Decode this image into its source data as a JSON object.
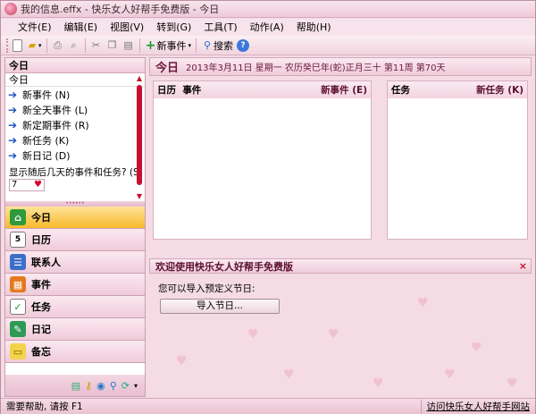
{
  "window": {
    "title": "我的信息.effx - 快乐女人好帮手免费版 - 今日"
  },
  "menu": [
    "文件(E)",
    "编辑(E)",
    "视图(V)",
    "转到(G)",
    "工具(T)",
    "动作(A)",
    "帮助(H)"
  ],
  "toolbar": {
    "new_event_label": "新事件",
    "search_label": "搜索",
    "help_label": "?"
  },
  "left_pane": {
    "header": "今日",
    "subheader": "今日",
    "actions": [
      "新事件 (N)",
      "新全天事件 (L)",
      "新定期事件 (R)",
      "新任务 (K)",
      "新日记 (D)"
    ],
    "days_question": "显示随后几天的事件和任务? (S)",
    "days_value": "7"
  },
  "nav": [
    "今日",
    "日历",
    "联系人",
    "事件",
    "任务",
    "日记",
    "备忘"
  ],
  "date_bar": {
    "label": "今日",
    "info": "2013年3月11日 星期一 农历癸巳年(蛇)正月三十   第11周 第70天"
  },
  "events_panel": {
    "col_calendar": "日历",
    "col_event": "事件",
    "new_label": "新事件 (E)"
  },
  "tasks_panel": {
    "title": "任务",
    "new_label": "新任务 (K)"
  },
  "welcome": {
    "title": "欢迎使用快乐女人好帮手免费版",
    "close": "×",
    "text": "您可以导入预定义节日:",
    "button": "导入节日..."
  },
  "statusbar": {
    "left": "需要帮助, 请按 F1",
    "right": "访问快乐女人好帮手网站"
  },
  "colors": {
    "accent": "#c8102e",
    "nav_active": "#f8b92a",
    "link": "#1d4fb8"
  }
}
